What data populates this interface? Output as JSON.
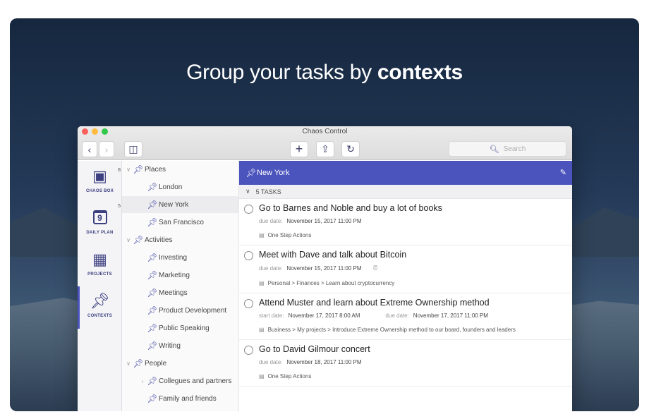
{
  "hero": {
    "headline_plain": "Group your tasks by ",
    "headline_bold": "contexts"
  },
  "window": {
    "title": "Chaos Control"
  },
  "toolbar": {
    "back": "‹",
    "forward": "›",
    "sidebar_toggle": "◫",
    "add": "+",
    "share": "⇪",
    "sync": "↻",
    "search_placeholder": "Search"
  },
  "rail": [
    {
      "label": "CHAOS BOX",
      "icon": "inbox-icon",
      "badge": "8"
    },
    {
      "label": "DAILY PLAN",
      "icon": "calendar-icon",
      "badge": "5",
      "icon_text": "9"
    },
    {
      "label": "PROJECTS",
      "icon": "grid-icon",
      "badge": ""
    },
    {
      "label": "CONTEXTS",
      "icon": "pin-icon",
      "badge": ""
    }
  ],
  "tree": [
    {
      "label": "Places",
      "level": 0,
      "expanded": true
    },
    {
      "label": "London",
      "level": 1
    },
    {
      "label": "New York",
      "level": 1,
      "selected": true
    },
    {
      "label": "San Francisco",
      "level": 1
    },
    {
      "label": "Activities",
      "level": 0,
      "expanded": true
    },
    {
      "label": "Investing",
      "level": 1
    },
    {
      "label": "Marketing",
      "level": 1
    },
    {
      "label": "Meetings",
      "level": 1
    },
    {
      "label": "Product Development",
      "level": 1
    },
    {
      "label": "Public Speaking",
      "level": 1
    },
    {
      "label": "Writing",
      "level": 1
    },
    {
      "label": "People",
      "level": 0,
      "expanded": true
    },
    {
      "label": "Collegues and partners",
      "level": 1,
      "collapsed": true
    },
    {
      "label": "Family and friends",
      "level": 1
    }
  ],
  "context": {
    "name": "New York",
    "task_count_label": "5 TASKS"
  },
  "tasks": [
    {
      "title": "Go to Barnes and Noble and buy a lot of books",
      "meta": [
        {
          "label": "due date:",
          "value": "November 15, 2017 11:00 PM"
        }
      ],
      "path": "One Step Actions",
      "alarm": false
    },
    {
      "title": "Meet with Dave and talk about Bitcoin",
      "meta": [
        {
          "label": "due date:",
          "value": "November 15, 2017 11:00 PM"
        }
      ],
      "path": "Personal > Finances > Learn about cryptocurrency",
      "alarm": true
    },
    {
      "title": "Attend Muster and learn about Extreme Ownership method",
      "meta": [
        {
          "label": "start date:",
          "value": "November 17, 2017 8:00 AM"
        },
        {
          "label": "due date:",
          "value": "November 17, 2017 11:00 PM"
        }
      ],
      "path": "Business > My projects > Introduce Extreme Ownership method to our board, founders and leaders",
      "alarm": false
    },
    {
      "title": "Go to David Gilmour concert",
      "meta": [
        {
          "label": "due date:",
          "value": "November 18, 2017 11:00 PM"
        }
      ],
      "path": "One Step Actions",
      "alarm": false
    }
  ],
  "colors": {
    "accent": "#4b54bd",
    "rail_icon": "#3d4080"
  }
}
